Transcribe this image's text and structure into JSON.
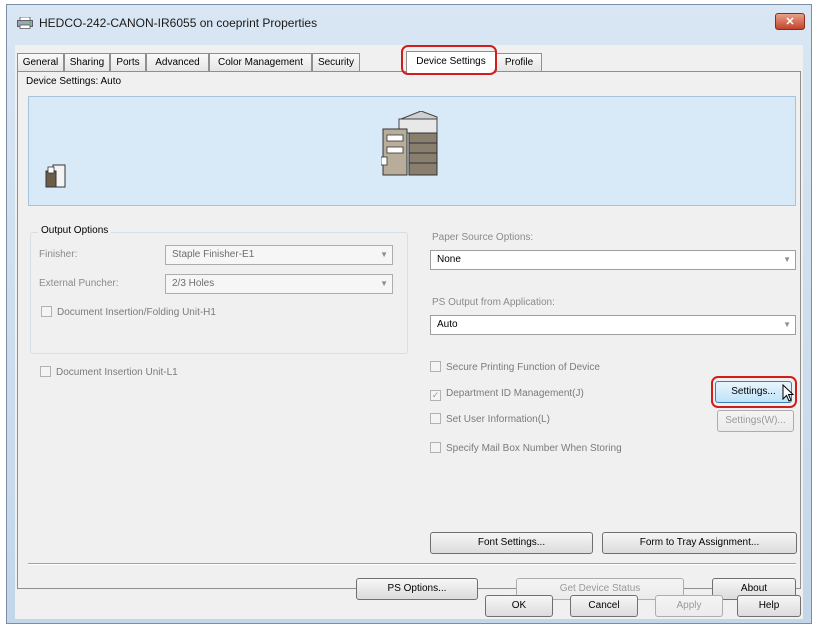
{
  "window": {
    "title": "HEDCO-242-CANON-IR6055 on coeprint Properties",
    "close_label": "✕"
  },
  "tabs": [
    {
      "label": "General"
    },
    {
      "label": "Sharing"
    },
    {
      "label": "Ports"
    },
    {
      "label": "Advanced"
    },
    {
      "label": "Color Management"
    },
    {
      "label": "Security"
    },
    {
      "label": "Device Settings",
      "active": true
    },
    {
      "label": "Profile"
    }
  ],
  "device_settings_label": "Device Settings: Auto",
  "output_options": {
    "legend": "Output Options",
    "finisher_label": "Finisher:",
    "finisher_value": "Staple Finisher-E1",
    "puncher_label": "External Puncher:",
    "puncher_value": "2/3 Holes",
    "doc_insertion_folding": "Document Insertion/Folding Unit-H1"
  },
  "doc_insertion_unit": "Document Insertion Unit-L1",
  "paper_source": {
    "label": "Paper Source Options:",
    "value": "None"
  },
  "ps_output": {
    "label": "PS Output from Application:",
    "value": "Auto"
  },
  "checks": {
    "secure_printing": "Secure Printing Function of Device",
    "department_id": "Department ID Management(J)",
    "set_user_info": "Set User Information(L)",
    "mail_box": "Specify Mail Box Number When Storing",
    "check_mark": "✓"
  },
  "buttons": {
    "settings": "Settings...",
    "settings_w": "Settings(W)...",
    "font_settings": "Font Settings...",
    "form_to_tray": "Form to Tray Assignment...",
    "ps_options": "PS Options...",
    "get_device_status": "Get Device Status",
    "about": "About",
    "ok": "OK",
    "cancel": "Cancel",
    "apply": "Apply",
    "help": "Help"
  },
  "colors": {
    "highlight": "#d31c1c",
    "preview_bg": "#d8eaf8"
  }
}
